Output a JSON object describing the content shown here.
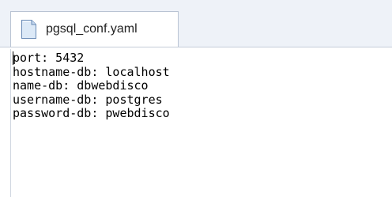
{
  "tab": {
    "title": "pgsql_conf.yaml",
    "icon": "document-icon"
  },
  "editor": {
    "lines": [
      "port: 5432",
      "hostname-db: localhost",
      "name-db: dbwebdisco",
      "username-db: postgres",
      "password-db: pwebdisco"
    ]
  },
  "colors": {
    "tabbar_bg": "#eef2f8",
    "tab_border": "#b9c3d3",
    "icon_fill": "#dce9f7",
    "icon_stroke": "#6a8bb6",
    "text": "#000000"
  }
}
